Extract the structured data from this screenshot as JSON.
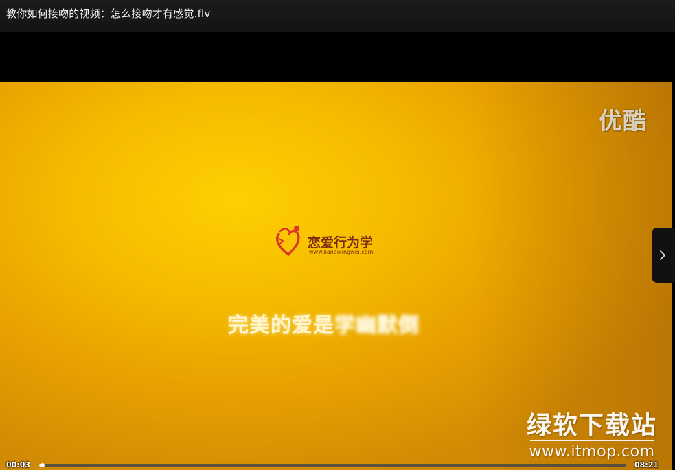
{
  "window": {
    "title": "教你如何接吻的视频：怎么接吻才有感觉.flv"
  },
  "video": {
    "watermark_youku": "优酷",
    "logo": {
      "name": "恋爱行为学",
      "url": "www.lianaixingwei.com"
    },
    "caption_clear": "完美的爱是",
    "caption_blurred": "学幽默倒"
  },
  "site_watermark": {
    "name": "绿软下载站",
    "url": "www.itmop.com"
  },
  "side_panel": {
    "icon": "chevron-right-icon"
  },
  "player": {
    "current_time": "00:03",
    "total_time": "08:21",
    "progress": 0.006
  },
  "colors": {
    "title_bar": "#161616",
    "video_bg": "#f5bb00",
    "logo_text": "#7b2a10",
    "logo_heart": "#d9342b"
  }
}
